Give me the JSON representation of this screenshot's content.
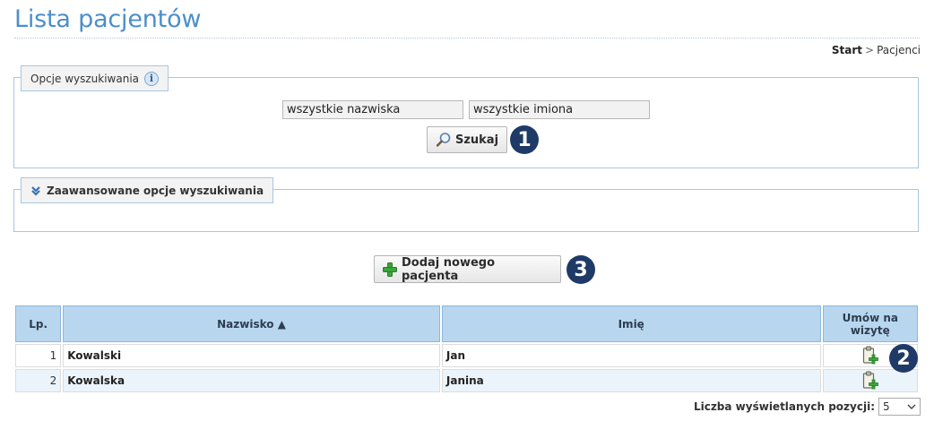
{
  "page": {
    "title": "Lista pacjentów"
  },
  "breadcrumb": {
    "home": "Start",
    "separator": ">",
    "current": "Pacjenci"
  },
  "search": {
    "legend": "Opcje wyszukiwania",
    "surname_placeholder": "wszystkie nazwiska",
    "firstname_placeholder": "wszystkie imiona",
    "submit_label": "Szukaj",
    "callout": "1"
  },
  "advanced": {
    "legend": "Zaawansowane opcje wyszukiwania"
  },
  "add_patient": {
    "label": "Dodaj nowego pacjenta",
    "callout": "3"
  },
  "table": {
    "headers": {
      "lp": "Lp.",
      "surname": "Nazwisko ▲",
      "firstname": "Imię",
      "appointment": "Umów na wizytę"
    },
    "rows": [
      {
        "lp": "1",
        "surname": "Kowalski",
        "firstname": "Jan"
      },
      {
        "lp": "2",
        "surname": "Kowalska",
        "firstname": "Janina"
      }
    ],
    "appointment_callout": "2"
  },
  "pager": {
    "label": "Liczba wyświetlanych pozycji:",
    "value": "5"
  },
  "colors": {
    "title": "#4b8fc9",
    "header_bg": "#b9d6ef",
    "callout_bg": "#1f3a66",
    "add_icon": "#3aa63a"
  },
  "icons": {
    "info": "info-icon",
    "chevron": "double-chevron-down-icon",
    "search": "magnifier-icon",
    "add": "plus-icon",
    "appointment": "clipboard-add-icon",
    "dropdown": "chevron-down-icon"
  }
}
